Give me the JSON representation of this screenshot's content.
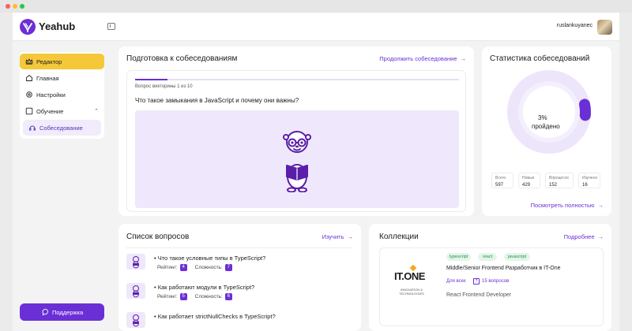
{
  "window_controls": [
    "close",
    "minimize",
    "maximize"
  ],
  "colors": {
    "accent": "#6b2fd6",
    "active_nav": "#f5c83a",
    "tag_bg": "#e2f6e8",
    "tag_text": "#2d8a4f"
  },
  "header": {
    "brand": "Yeahub",
    "username": "ruslankuyanec"
  },
  "sidebar": {
    "items": [
      {
        "label": "Редактор",
        "icon": "crown-icon",
        "active": true
      },
      {
        "label": "Главная",
        "icon": "home-icon"
      },
      {
        "label": "Настройки",
        "icon": "gear-icon"
      },
      {
        "label": "Обучение",
        "icon": "book-icon",
        "expanded": true
      },
      {
        "label": "Собеседование",
        "icon": "interview-icon",
        "sub": true
      }
    ],
    "support_label": "Поддержка"
  },
  "prep": {
    "title": "Подготовка к собеседованиям",
    "link": "Продолжить собеседование",
    "progress_label": "Вопрос викторины 1 из 10",
    "progress_value": 0.1,
    "question": "Что такое замыкания в JavaScript и почему они важны?"
  },
  "stats": {
    "title": "Статистика собеседований",
    "percent": "3%",
    "percent_label": "пройдено",
    "progress_value": 0.03,
    "boxes": [
      {
        "label": "Всего",
        "value": "597"
      },
      {
        "label": "Новые",
        "value": "429"
      },
      {
        "label": "Впроцессе",
        "value": "152"
      },
      {
        "label": "Изучено",
        "value": "16"
      }
    ],
    "link": "Посмотреть полностью"
  },
  "questions": {
    "title": "Список вопросов",
    "link": "Изучить",
    "rating_label": "Рейтинг:",
    "difficulty_label": "Сложность:",
    "items": [
      {
        "title": "• Что такое условные типы в TypeScript?",
        "rating": "4",
        "difficulty": "7"
      },
      {
        "title": "• Как работают модули в TypeScript?",
        "rating": "5",
        "difficulty": "6"
      },
      {
        "title": "• Как работает strictNullChecks в TypeScript?",
        "rating": "",
        "difficulty": ""
      }
    ]
  },
  "collections": {
    "title": "Коллекции",
    "link": "Подробнее",
    "item": {
      "logo_main": "IT.ONE",
      "logo_sub_1": "INNOVATION &",
      "logo_sub_2": "TECHNOLOGIES",
      "tags": [
        "typescript",
        "react",
        "javascript"
      ],
      "name": "Middle/Senior Frontend Разработчик в IT-One",
      "access": "Для всех",
      "count": "15 вопросов",
      "subtitle": "React Frontend Developer"
    }
  }
}
